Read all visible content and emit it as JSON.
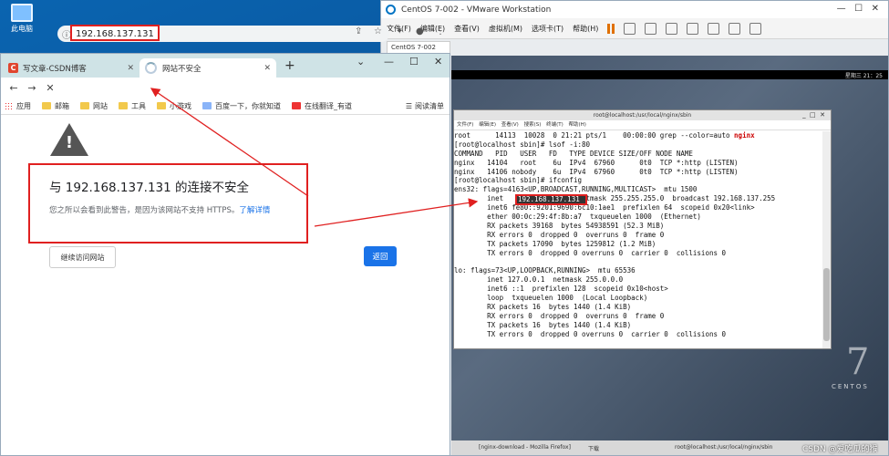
{
  "desktop": {
    "icon_label": "此电脑"
  },
  "chrome": {
    "tabs": [
      {
        "label": "写文章-CSDN博客"
      },
      {
        "label": "网站不安全"
      }
    ],
    "url": "192.168.137.131",
    "bookmarks": [
      "应用",
      "邮箱",
      "网站",
      "工具",
      "小游戏",
      "百度一下，你就知道",
      "在线翻译_有道",
      "阅读清单"
    ],
    "error_title": "与 192.168.137.131 的连接不安全",
    "error_desc": "您之所以会看到此警告，是因为该网站不支持 HTTPS。",
    "learn_more": "了解详情",
    "continue_button": "继续访问网站",
    "back_button": "返回"
  },
  "vmware": {
    "title": "CentOS 7-002 - VMware Workstation",
    "menu": [
      "文件(F)",
      "编辑(E)",
      "查看(V)",
      "虚拟机(M)",
      "选项卡(T)",
      "帮助(H)"
    ],
    "vm_tab": "CentOS 7-002",
    "clock": "星期三 21：25",
    "centos_num": "7",
    "centos_text": "CENTOS"
  },
  "terminal": {
    "title": "root@localhost:/usr/local/nginx/sbin",
    "menu": [
      "文件(F)",
      "编辑(E)",
      "查看(V)",
      "搜索(S)",
      "终端(T)",
      "帮助(H)"
    ],
    "lines": [
      "root      14113  10028  0 21:21 pts/1    00:00:00 grep --color=auto ",
      "[root@localhost sbin]# lsof -i:80",
      "COMMAND   PID   USER   FD   TYPE DEVICE SIZE/OFF NODE NAME",
      "nginx   14104   root    6u  IPv4  67960      0t0  TCP *:http (LISTEN)",
      "nginx   14106 nobody    6u  IPv4  67960      0t0  TCP *:http (LISTEN)",
      "[root@localhost sbin]# ifconfig",
      "ens32: flags=4163<UP,BROADCAST,RUNNING,MULTICAST>  mtu 1500",
      "        inet                  netmask 255.255.255.0  broadcast 192.168.137.255",
      "        inet6 fe80::9201:9690:6c10:1ae1  prefixlen 64  scopeid 0x20<link>",
      "        ether 00:0c:29:4f:8b:a7  txqueuelen 1000  (Ethernet)",
      "        RX packets 39168  bytes 54938591 (52.3 MiB)",
      "        RX errors 0  dropped 0  overruns 0  frame 0",
      "        TX packets 17090  bytes 1259812 (1.2 MiB)",
      "        TX errors 0  dropped 0 overruns 0  carrier 0  collisions 0",
      "",
      "lo: flags=73<UP,LOOPBACK,RUNNING>  mtu 65536",
      "        inet 127.0.0.1  netmask 255.0.0.0",
      "        inet6 ::1  prefixlen 128  scopeid 0x10<host>",
      "        loop  txqueuelen 1000  (Local Loopback)",
      "        RX packets 16  bytes 1440 (1.4 KiB)",
      "        RX errors 0  dropped 0  overruns 0  frame 0",
      "        TX packets 16  bytes 1440 (1.4 KiB)",
      "        TX errors 0  dropped 0 overruns 0  carrier 0  collisions 0"
    ],
    "grep_highlight": "nginx",
    "inet_ip": "192.168.137.131"
  },
  "guest_taskbar": [
    "[nginx-download - Mozilla Firefox]",
    "下载",
    "root@localhost:/usr/local/nginx/sbin"
  ],
  "watermark": "CSDN @爱吃瓜的猴",
  "colors": {
    "annotation": "#e02020",
    "link": "#1a73e8",
    "guest_bg": "#44546a"
  }
}
